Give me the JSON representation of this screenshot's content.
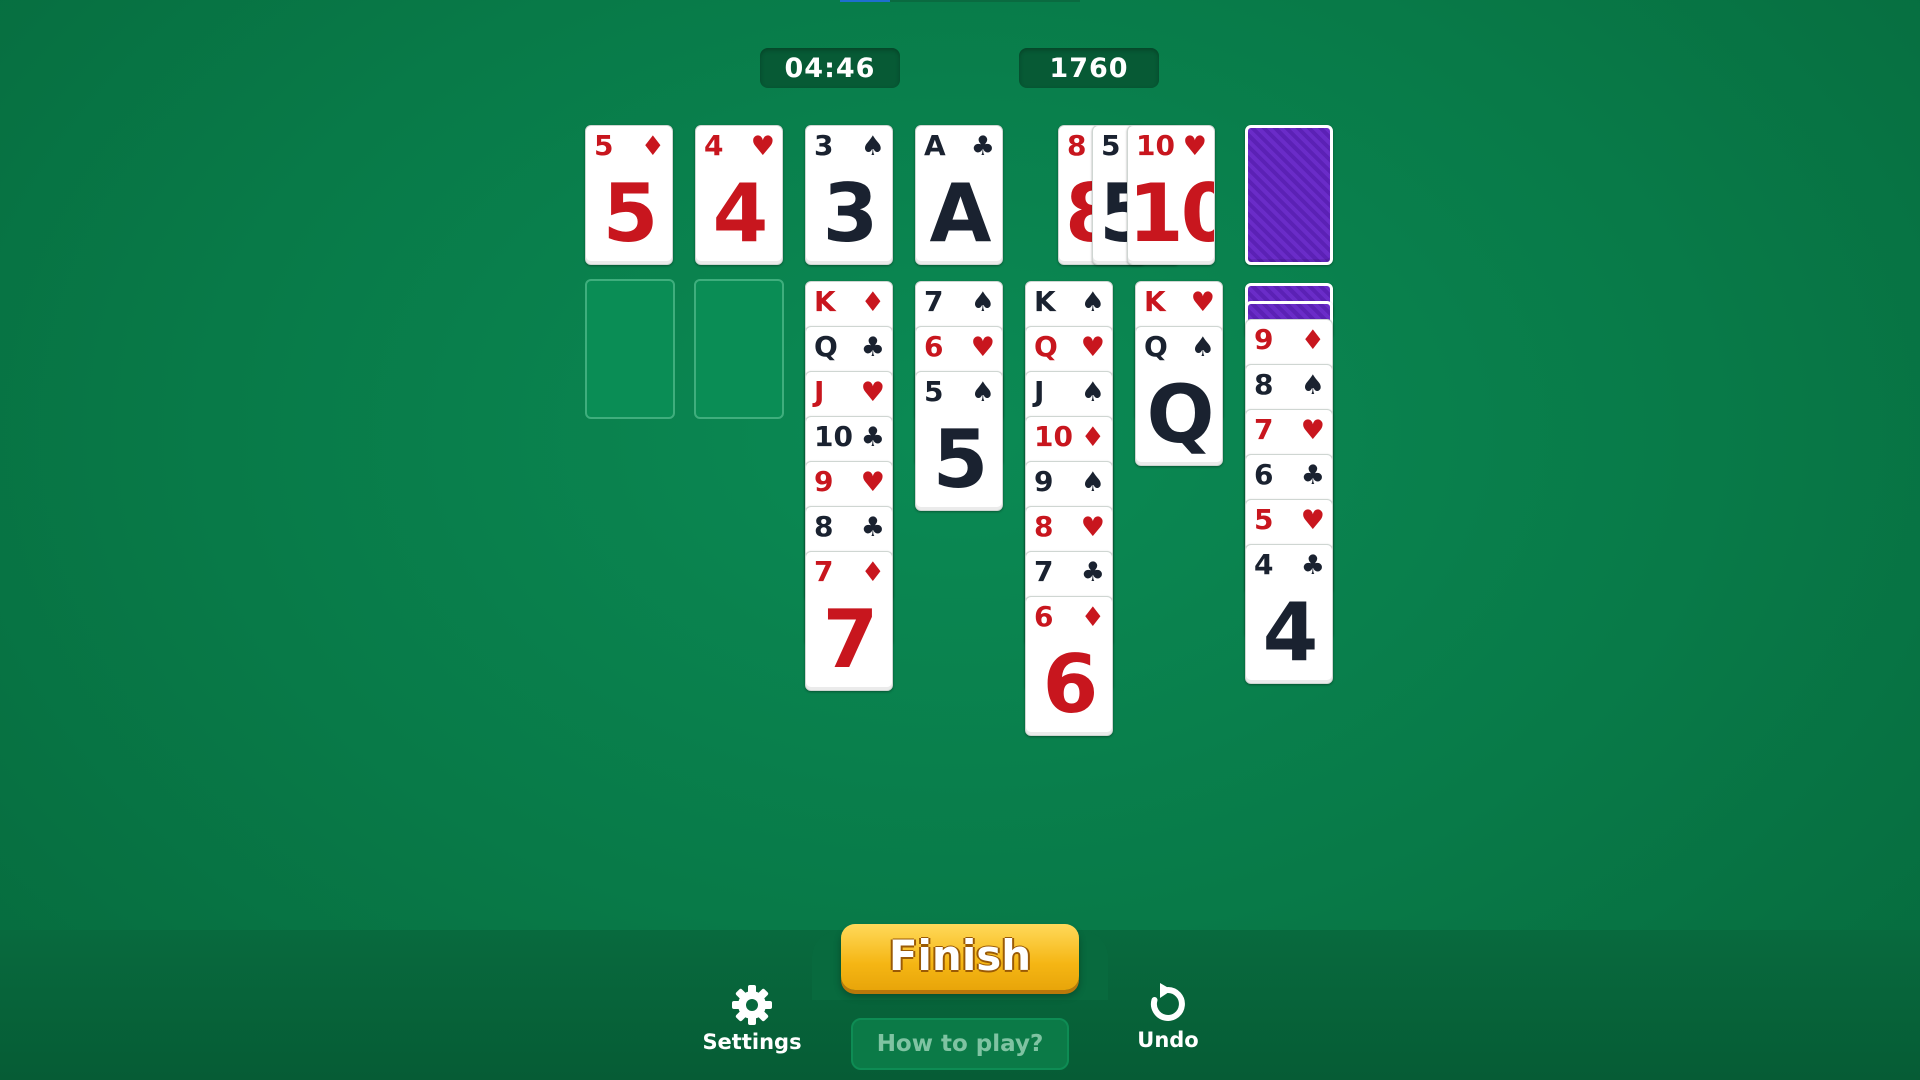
{
  "timer": "04:46",
  "score": "1760",
  "suits": {
    "hearts": "♥",
    "diamonds": "♦",
    "spades": "♠",
    "clubs": "♣"
  },
  "colors": {
    "felt": "#087a48",
    "red_suit": "#c8161e",
    "black_suit": "#1a2230",
    "card_back": "#5b21b5",
    "finish_button": "#f5b614"
  },
  "foundations": [
    {
      "rank": "5",
      "suit": "♦"
    },
    {
      "rank": "4",
      "suit": "♥"
    },
    {
      "rank": "3",
      "suit": "♠"
    },
    {
      "rank": "A",
      "suit": "♣"
    }
  ],
  "waste": [
    {
      "rank": "8",
      "suit": ""
    },
    {
      "rank": "5",
      "suit": ""
    },
    {
      "rank": "10",
      "suit": "♥"
    }
  ],
  "stock": {
    "icon": "card-back"
  },
  "tableau": {
    "col3": [
      "K♦",
      "Q♣",
      "J♥",
      "10♣",
      "9♥",
      "8♣",
      "7♦"
    ],
    "col4": [
      "7♠",
      "6♥",
      "5♠"
    ],
    "col5": [
      "K♠",
      "Q♥",
      "J♠",
      "10♦",
      "9♠",
      "8♥",
      "7♣",
      "6♦"
    ],
    "col6": [
      "K♥",
      "Q♠"
    ],
    "col7": [
      "9♦",
      "8♠",
      "7♥",
      "6♣",
      "5♥",
      "4♣"
    ]
  },
  "buttons": {
    "finish": "Finish",
    "how_to_play": "How to play?",
    "settings": "Settings",
    "undo": "Undo"
  }
}
